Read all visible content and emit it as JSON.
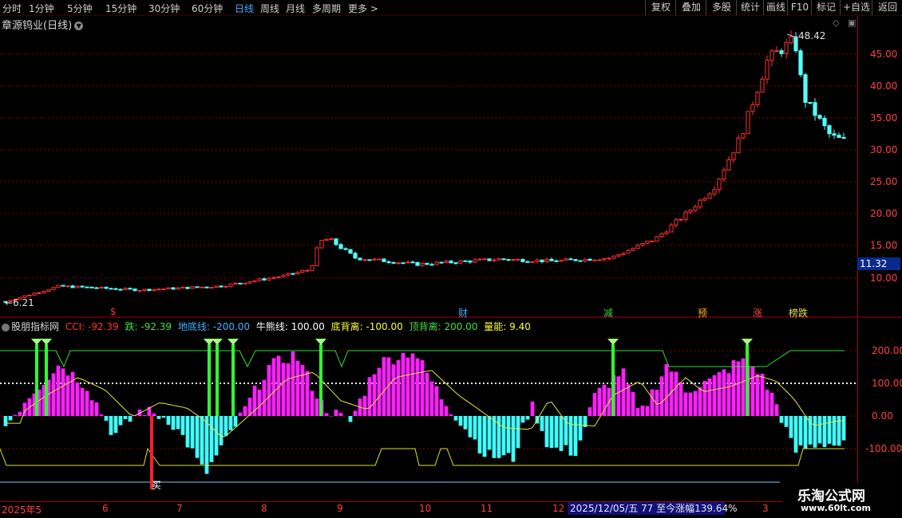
{
  "toolbar": {
    "periods": [
      "分时",
      "1分钟",
      "5分钟",
      "15分钟",
      "30分钟",
      "60分钟",
      "日线",
      "周线",
      "月线",
      "多周期",
      "更多 >"
    ],
    "active_period": "日线",
    "right_buttons": [
      "复权",
      "叠加",
      "多股",
      "统计",
      "画线",
      "F10",
      "标记",
      "+自选",
      "返回"
    ]
  },
  "stock": {
    "title": "章源钨业(日线)"
  },
  "price_axis": {
    "labels": [
      "45.00",
      "40.00",
      "35.00",
      "30.00",
      "25.00",
      "20.00",
      "15.00",
      "10.00"
    ],
    "current_price": "11.32",
    "high_label": "48.42",
    "low_label": "6.21"
  },
  "events": [
    {
      "text": "$",
      "color": "#ff3030"
    },
    {
      "text": "财",
      "color": "#4aa8ff"
    },
    {
      "text": "减",
      "color": "#40d040"
    },
    {
      "text": "预",
      "color": "#ffb020"
    },
    {
      "text": "涨",
      "color": "#ff4040"
    },
    {
      "text": "榜跌",
      "color": "#e0e040"
    }
  ],
  "indicator": {
    "name": "股朋指标网",
    "items": [
      {
        "label": "CCI: -92.39",
        "color": "#ff3030"
      },
      {
        "label": "跌: -92.39",
        "color": "#40e040"
      },
      {
        "label": "地底线: -200.00",
        "color": "#40b0ff"
      },
      {
        "label": "牛熊线: 100.00",
        "color": "#ffffff"
      },
      {
        "label": "底背离: -100.00",
        "color": "#ffff40"
      },
      {
        "label": "顶背离: 200.00",
        "color": "#40e040"
      },
      {
        "label": "量能: 9.40",
        "color": "#ffff40"
      }
    ],
    "axis_labels": [
      "200.00",
      "100.00",
      "0.00",
      "-100.00"
    ],
    "buy_marks": [
      "买"
    ]
  },
  "dates": [
    "2025年5",
    "6",
    "7",
    "8",
    "9",
    "10",
    "11",
    "12",
    "3"
  ],
  "status_box": "2025/12/05/五 77 至今涨幅139.64%",
  "watermark": {
    "title": "乐淘公式网",
    "url": "www.60lt.com"
  },
  "colors": {
    "up": "#ff3030",
    "down": "#54ffff",
    "grid": "#8b0000",
    "magenta": "#ff20ff",
    "cyan": "#40ffff"
  }
}
